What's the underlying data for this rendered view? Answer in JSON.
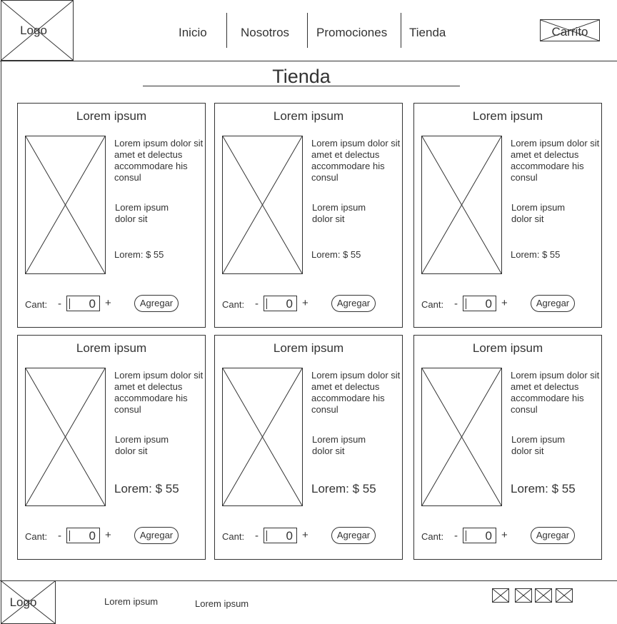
{
  "header": {
    "logo_text": "Logo",
    "nav": [
      "Inicio",
      "Nosotros",
      "Promociones",
      "Tienda"
    ],
    "cart_label": "Carrito"
  },
  "page": {
    "title": "Tienda"
  },
  "products": [
    {
      "title": "Lorem ipsum",
      "description": "Lorem ipsum dolor sit amet et delectus accommodare his consul",
      "subtext": "Lorem ipsum dolor sit",
      "price": "Lorem: $ 55",
      "qty_label": "Cant:",
      "minus": "-",
      "qty": "0",
      "plus": "+",
      "add_label": "Agregar"
    },
    {
      "title": "Lorem ipsum",
      "description": "Lorem ipsum dolor sit amet et delectus accommodare his consul",
      "subtext": "Lorem ipsum dolor sit",
      "price": "Lorem: $ 55",
      "qty_label": "Cant:",
      "minus": "-",
      "qty": "0",
      "plus": "+",
      "add_label": "Agregar"
    },
    {
      "title": "Lorem ipsum",
      "description": "Lorem ipsum dolor sit amet et delectus accommodare his consul",
      "subtext": "Lorem ipsum dolor sit",
      "price": "Lorem: $ 55",
      "qty_label": "Cant:",
      "minus": "-",
      "qty": "0",
      "plus": "+",
      "add_label": "Agregar"
    },
    {
      "title": "Lorem ipsum",
      "description": "Lorem ipsum dolor sit amet et delectus accommodare his consul",
      "subtext": "Lorem ipsum dolor sit",
      "price": "Lorem: $ 55",
      "qty_label": "Cant:",
      "minus": "-",
      "qty": "0",
      "plus": "+",
      "add_label": "Agregar"
    },
    {
      "title": "Lorem ipsum",
      "description": "Lorem ipsum dolor sit amet et delectus accommodare his consul",
      "subtext": "Lorem ipsum dolor sit",
      "price": "Lorem: $ 55",
      "qty_label": "Cant:",
      "minus": "-",
      "qty": "0",
      "plus": "+",
      "add_label": "Agregar"
    },
    {
      "title": "Lorem ipsum",
      "description": "Lorem ipsum dolor sit amet et delectus accommodare his consul",
      "subtext": "Lorem ipsum dolor sit",
      "price": "Lorem: $ 55",
      "qty_label": "Cant:",
      "minus": "-",
      "qty": "0",
      "plus": "+",
      "add_label": "Agregar"
    }
  ],
  "footer": {
    "logo_text": "Logo",
    "links": [
      "Lorem ipsum",
      "Lorem ipsum"
    ]
  }
}
